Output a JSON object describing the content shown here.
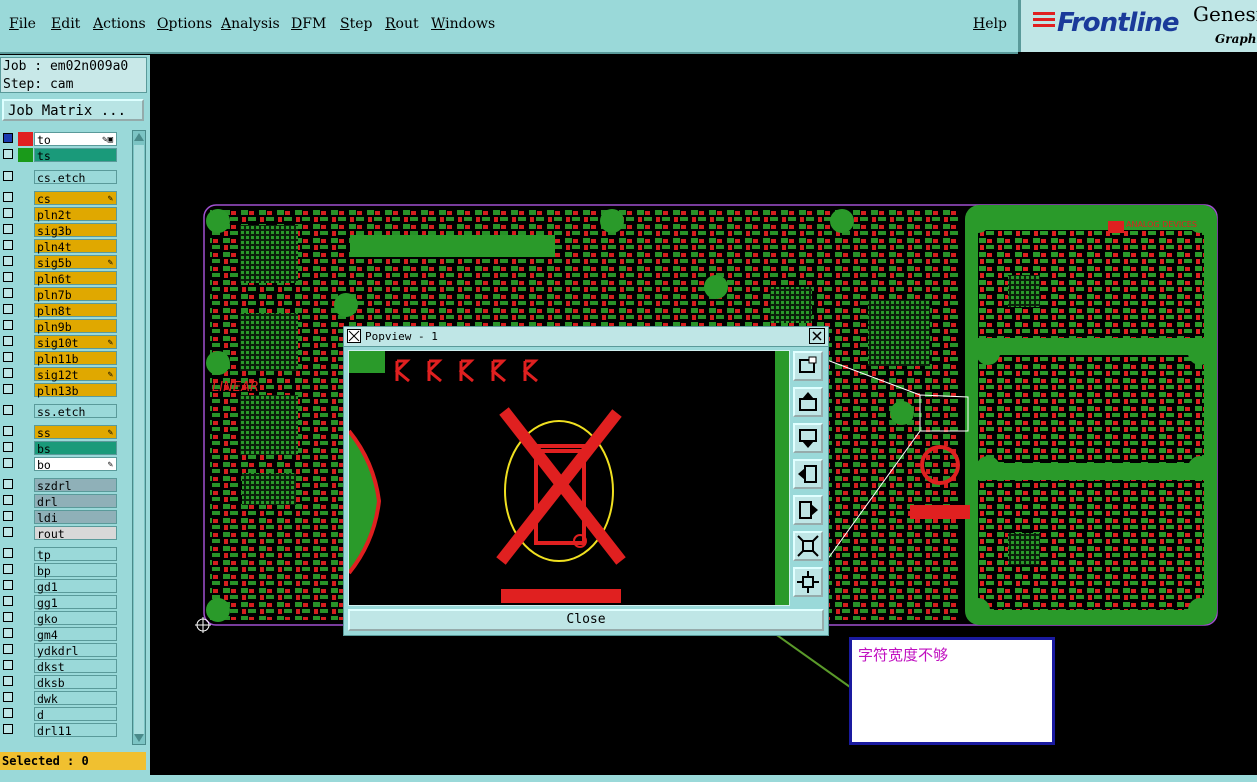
{
  "menu": {
    "items": [
      "File",
      "Edit",
      "Actions",
      "Options",
      "Analysis",
      "DFM",
      "Step",
      "Rout",
      "Windows"
    ],
    "help": "Help"
  },
  "logo": {
    "brand": "Frontline",
    "product": "Genesis",
    "subtitle": "Graphic"
  },
  "job": {
    "job_line": "Job : em02n009a0",
    "step_line": "Step: cam",
    "matrix_button": "Job Matrix ..."
  },
  "layers": [
    {
      "name": "to",
      "color": "#ffffff",
      "swatch": "#e02020",
      "checked": true,
      "flag": "✎▣"
    },
    {
      "name": "ts",
      "color": "#1a9a7a",
      "swatch": "#1a9a1a",
      "checked": false,
      "flag": ""
    },
    {
      "name": "cs.etch",
      "color": "#9ad9d9",
      "swatch": "",
      "checked": false,
      "flag": ""
    },
    {
      "name": "cs",
      "color": "#e0a800",
      "swatch": "",
      "checked": false,
      "flag": "✎"
    },
    {
      "name": "pln2t",
      "color": "#e0a800",
      "swatch": "",
      "checked": false,
      "flag": ""
    },
    {
      "name": "sig3b",
      "color": "#e0a800",
      "swatch": "",
      "checked": false,
      "flag": ""
    },
    {
      "name": "pln4t",
      "color": "#e0a800",
      "swatch": "",
      "checked": false,
      "flag": ""
    },
    {
      "name": "sig5b",
      "color": "#e0a800",
      "swatch": "",
      "checked": false,
      "flag": "✎"
    },
    {
      "name": "pln6t",
      "color": "#e0a800",
      "swatch": "",
      "checked": false,
      "flag": ""
    },
    {
      "name": "pln7b",
      "color": "#e0a800",
      "swatch": "",
      "checked": false,
      "flag": ""
    },
    {
      "name": "pln8t",
      "color": "#e0a800",
      "swatch": "",
      "checked": false,
      "flag": ""
    },
    {
      "name": "pln9b",
      "color": "#e0a800",
      "swatch": "",
      "checked": false,
      "flag": ""
    },
    {
      "name": "sig10t",
      "color": "#e0a800",
      "swatch": "",
      "checked": false,
      "flag": "✎"
    },
    {
      "name": "pln11b",
      "color": "#e0a800",
      "swatch": "",
      "checked": false,
      "flag": ""
    },
    {
      "name": "sig12t",
      "color": "#e0a800",
      "swatch": "",
      "checked": false,
      "flag": "✎"
    },
    {
      "name": "pln13b",
      "color": "#e0a800",
      "swatch": "",
      "checked": false,
      "flag": ""
    },
    {
      "name": "ss.etch",
      "color": "#9ad9d9",
      "swatch": "",
      "checked": false,
      "flag": ""
    },
    {
      "name": "ss",
      "color": "#e0a800",
      "swatch": "",
      "checked": false,
      "flag": "✎"
    },
    {
      "name": "bs",
      "color": "#1a9a7a",
      "swatch": "",
      "checked": false,
      "flag": ""
    },
    {
      "name": "bo",
      "color": "#ffffff",
      "swatch": "",
      "checked": false,
      "flag": "✎"
    },
    {
      "name": "szdrl",
      "color": "#8fb0b8",
      "swatch": "",
      "checked": false,
      "flag": ""
    },
    {
      "name": "drl",
      "color": "#8fb0b8",
      "swatch": "",
      "checked": false,
      "flag": ""
    },
    {
      "name": "ldi",
      "color": "#8fb0b8",
      "swatch": "",
      "checked": false,
      "flag": ""
    },
    {
      "name": "rout",
      "color": "#d8d8d8",
      "swatch": "",
      "checked": false,
      "flag": ""
    },
    {
      "name": "tp",
      "color": "#9ad9d9",
      "swatch": "",
      "checked": false,
      "flag": ""
    },
    {
      "name": "bp",
      "color": "#9ad9d9",
      "swatch": "",
      "checked": false,
      "flag": ""
    },
    {
      "name": "gd1",
      "color": "#9ad9d9",
      "swatch": "",
      "checked": false,
      "flag": ""
    },
    {
      "name": "gg1",
      "color": "#9ad9d9",
      "swatch": "",
      "checked": false,
      "flag": ""
    },
    {
      "name": "gko",
      "color": "#9ad9d9",
      "swatch": "",
      "checked": false,
      "flag": ""
    },
    {
      "name": "gm4",
      "color": "#9ad9d9",
      "swatch": "",
      "checked": false,
      "flag": ""
    },
    {
      "name": "ydkdrl",
      "color": "#9ad9d9",
      "swatch": "",
      "checked": false,
      "flag": ""
    },
    {
      "name": "dkst",
      "color": "#9ad9d9",
      "swatch": "",
      "checked": false,
      "flag": ""
    },
    {
      "name": "dksb",
      "color": "#9ad9d9",
      "swatch": "",
      "checked": false,
      "flag": ""
    },
    {
      "name": "dwk",
      "color": "#9ad9d9",
      "swatch": "",
      "checked": false,
      "flag": ""
    },
    {
      "name": "d",
      "color": "#9ad9d9",
      "swatch": "",
      "checked": false,
      "flag": ""
    },
    {
      "name": "drl11",
      "color": "#9ad9d9",
      "swatch": "",
      "checked": false,
      "flag": ""
    }
  ],
  "selected": "Selected : 0",
  "popview": {
    "title": "Popview - 1",
    "close": "Close"
  },
  "board": {
    "brand_left": "LINEAR",
    "brand_right": "ANALOG DEVICES"
  },
  "annotation": "字符宽度不够"
}
